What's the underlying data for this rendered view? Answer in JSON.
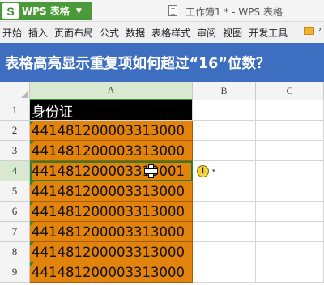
{
  "app": {
    "logo_glyph": "S",
    "name": "WPS 表格",
    "window_title": "工作簿1 * - WPS 表格"
  },
  "menu": {
    "items": [
      "开始",
      "插入",
      "页面布局",
      "公式",
      "数据",
      "表格样式",
      "审阅",
      "视图",
      "开发工具"
    ]
  },
  "banner": {
    "text": "表格高亮显示重复项如何超过“16”位数？",
    "color": "#3e6ec0"
  },
  "sheet": {
    "columns": [
      "A",
      "B",
      "C"
    ],
    "active_column": "A",
    "active_row": "4",
    "rows": [
      {
        "num": "1",
        "a": "身份证"
      },
      {
        "num": "2",
        "a": "44148120000331300‌0"
      },
      {
        "num": "3",
        "a": "441481200003313000"
      },
      {
        "num": "4",
        "a": "441481200003313001"
      },
      {
        "num": "5",
        "a": "441481200003313000"
      },
      {
        "num": "6",
        "a": "441481200003313000"
      },
      {
        "num": "7",
        "a": "441481200003313000"
      },
      {
        "num": "8",
        "a": "441481200003313000"
      },
      {
        "num": "9",
        "a": "441481200003313000"
      }
    ],
    "highlight_color": "#e2830c",
    "header_fill": "#000000"
  },
  "warning": {
    "icon_glyph": "!",
    "caret": "▾"
  }
}
